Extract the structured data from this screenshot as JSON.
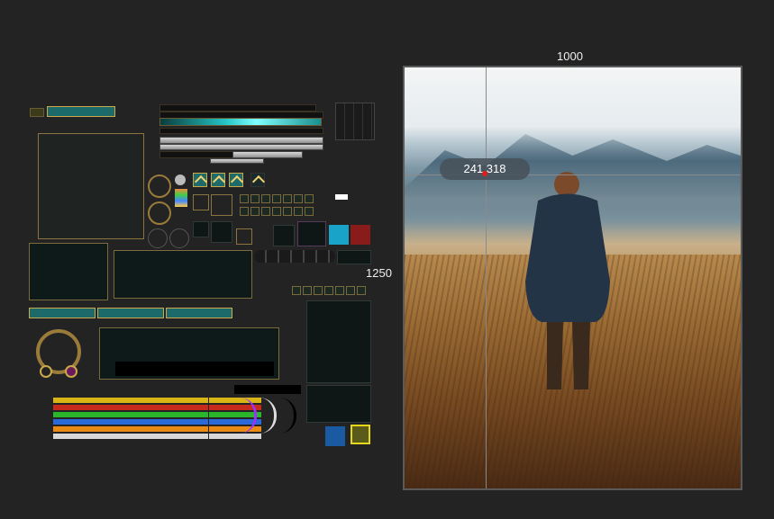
{
  "canvas": {
    "width_label": "1000",
    "height_label": "1250"
  },
  "cursor_readout": {
    "text": "241.318"
  },
  "icons": {
    "chevrons": [
      "chevron-up-icon",
      "chevron-up-icon",
      "chevron-up-icon",
      "chevron-up-icon"
    ]
  },
  "colors": {
    "background": "#232323",
    "gold_trim": "#8a7440",
    "teal": "#23c3c3",
    "guide": "#8a8a8a",
    "marker": "#e21b1b"
  }
}
